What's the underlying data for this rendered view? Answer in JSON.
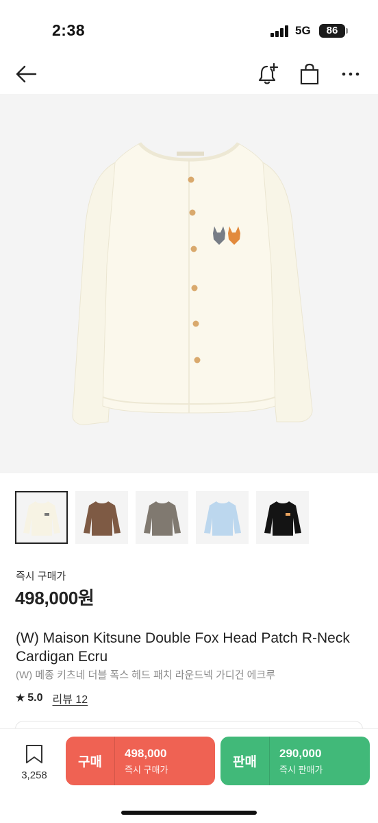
{
  "status": {
    "time": "2:38",
    "network": "5G",
    "battery": "86"
  },
  "colors": {
    "buy": "#ef6253",
    "sell": "#41b979",
    "product": "#f8f4e6"
  },
  "nav": {
    "back_icon": "arrow-left-icon",
    "notify_icon": "bell-plus-icon",
    "bag_icon": "shopping-bag-icon",
    "more_icon": "more-horizontal-icon"
  },
  "thumbnails": [
    {
      "color": "#f7f3e4",
      "selected": true
    },
    {
      "color": "#7e5a44",
      "selected": false
    },
    {
      "color": "#807970",
      "selected": false
    },
    {
      "color": "#bcd7ee",
      "selected": false
    },
    {
      "color": "#141414",
      "selected": false
    }
  ],
  "product": {
    "price_label": "즉시 구매가",
    "price": "498,000원",
    "title_en": "(W) Maison Kitsune Double Fox Head Patch R-Neck Cardigan Ecru",
    "title_ko": "(W) 메종 키츠네 더블 폭스 헤드 패치 라운드넥 가디건 에크루",
    "rating": "5.0",
    "review_label": "리뷰 12"
  },
  "bottom": {
    "wish_count": "3,258",
    "buy": {
      "label": "구매",
      "price": "498,000",
      "sub": "즉시 구매가"
    },
    "sell": {
      "label": "판매",
      "price": "290,000",
      "sub": "즉시 판매가"
    }
  }
}
